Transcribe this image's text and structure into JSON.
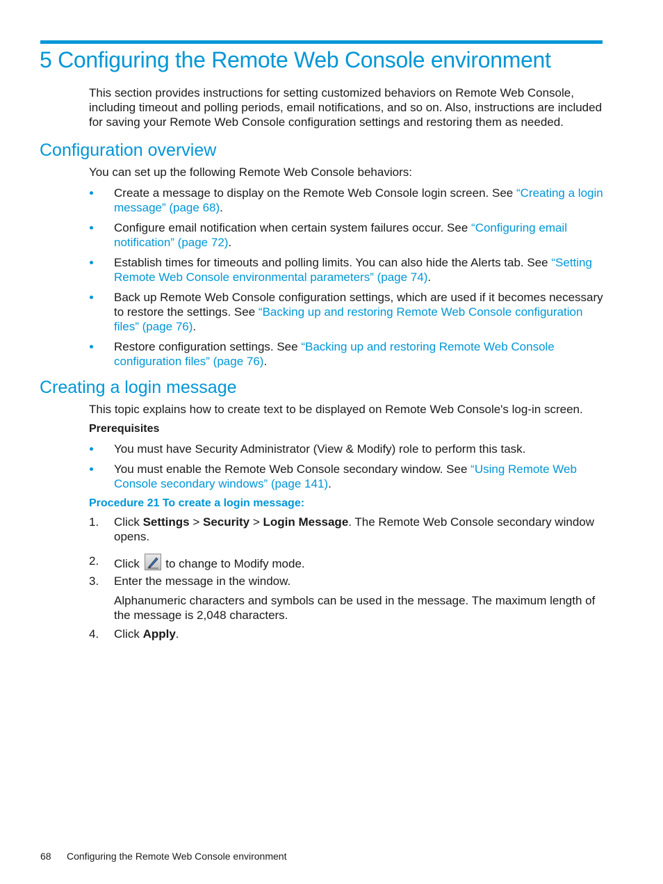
{
  "chapter": {
    "title": "5 Configuring the Remote Web Console environment",
    "intro": "This section provides instructions for setting customized behaviors on Remote Web Console, including timeout and polling periods, email notifications, and so on. Also, instructions are included for saving your Remote Web Console configuration settings and restoring them as needed."
  },
  "overview": {
    "heading": "Configuration overview",
    "lead": "You can set up the following Remote Web Console behaviors:",
    "items": [
      {
        "text": "Create a message to display on the Remote Web Console login screen. See ",
        "link": "“Creating a login message” (page 68)",
        "end": "."
      },
      {
        "text": "Configure email notification when certain system failures occur. See ",
        "link": "“Configuring email notification” (page 72)",
        "end": "."
      },
      {
        "text": "Establish times for timeouts and polling limits. You can also hide the Alerts tab. See ",
        "link": "“Setting Remote Web Console environmental parameters” (page 74)",
        "end": "."
      },
      {
        "text": "Back up Remote Web Console configuration settings, which are used if it becomes necessary to restore the settings. See ",
        "link": "“Backing up and restoring Remote Web Console configuration files” (page 76)",
        "end": "."
      },
      {
        "text": "Restore configuration settings. See ",
        "link": "“Backing up and restoring Remote Web Console configuration files” (page 76)",
        "end": "."
      }
    ]
  },
  "login_message": {
    "heading": "Creating a login message",
    "lead": "This topic explains how to create text to be displayed on Remote Web Console's log-in screen.",
    "prereq_label": "Prerequisites",
    "prereqs": [
      {
        "text": "You must have Security Administrator (View & Modify) role to perform this task.",
        "link": "",
        "end": ""
      },
      {
        "text": "You must enable the Remote Web Console secondary window. See ",
        "link": "“Using Remote Web Console secondary windows” (page 141)",
        "end": "."
      }
    ],
    "procedure_title": "Procedure 21 To create a login message:",
    "steps": {
      "s1": {
        "num": "1.",
        "pre": "Click ",
        "b1": "Settings",
        "sep1": " > ",
        "b2": "Security",
        "sep2": " > ",
        "b3": "Login Message",
        "post": ". The Remote Web Console secondary window opens."
      },
      "s2": {
        "num": "2.",
        "pre": "Click ",
        "icon": "modify-pen-icon",
        "post": " to change to Modify mode."
      },
      "s3": {
        "num": "3.",
        "text": "Enter the message in the window.",
        "note": "Alphanumeric characters and symbols can be used in the message. The maximum length of the message is 2,048 characters."
      },
      "s4": {
        "num": "4.",
        "pre": "Click ",
        "b1": "Apply",
        "post": "."
      }
    }
  },
  "footer": {
    "page_number": "68",
    "running_title": "Configuring the Remote Web Console environment"
  },
  "colors": {
    "accent": "#0096d6",
    "text": "#1a1a1a"
  }
}
